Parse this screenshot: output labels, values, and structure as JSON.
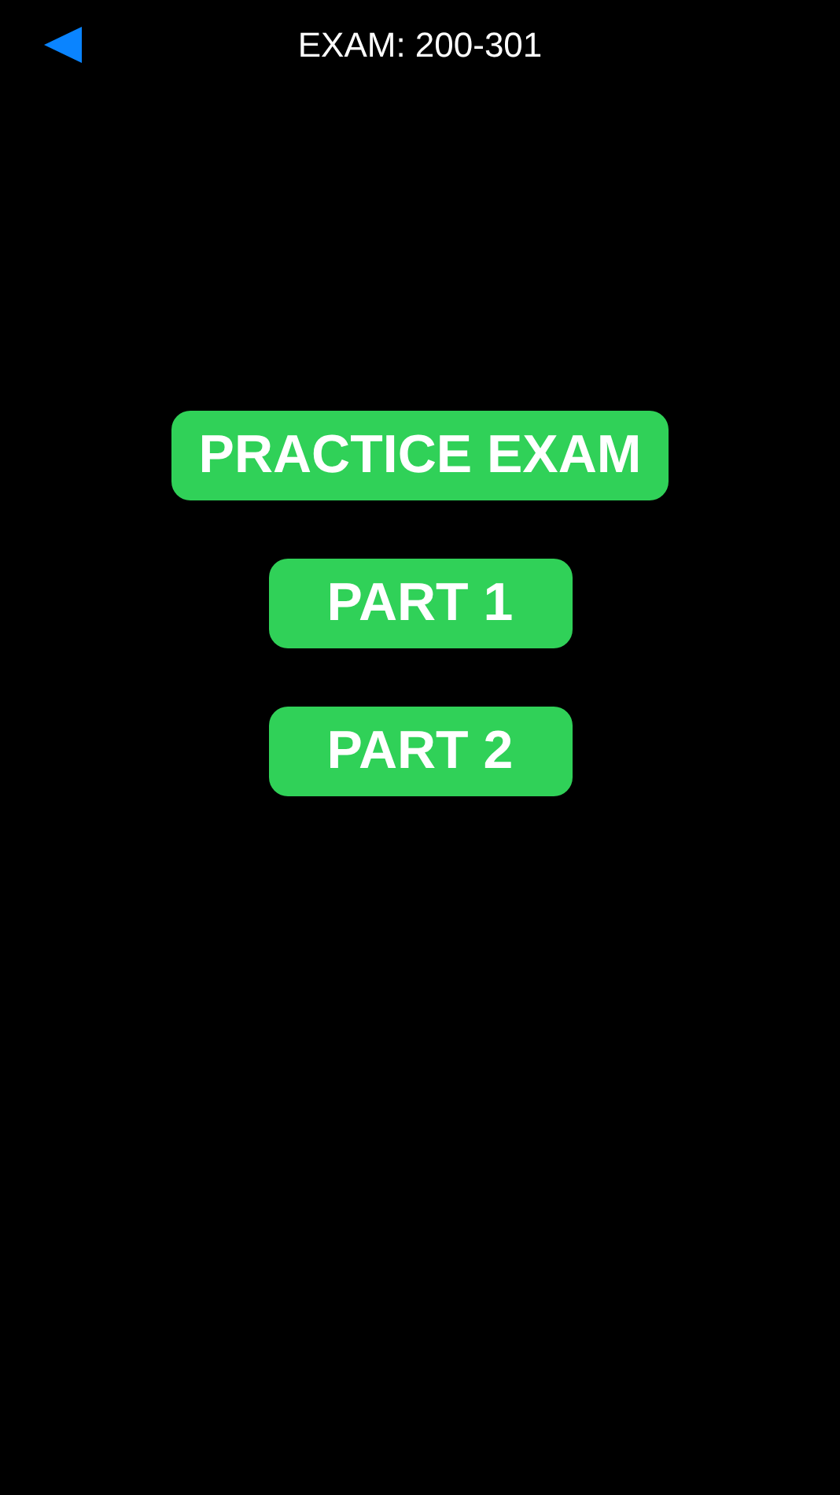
{
  "header": {
    "title": "EXAM: 200-301"
  },
  "buttons": [
    {
      "label": "PRACTICE EXAM"
    },
    {
      "label": "PART 1"
    },
    {
      "label": "PART 2"
    }
  ]
}
